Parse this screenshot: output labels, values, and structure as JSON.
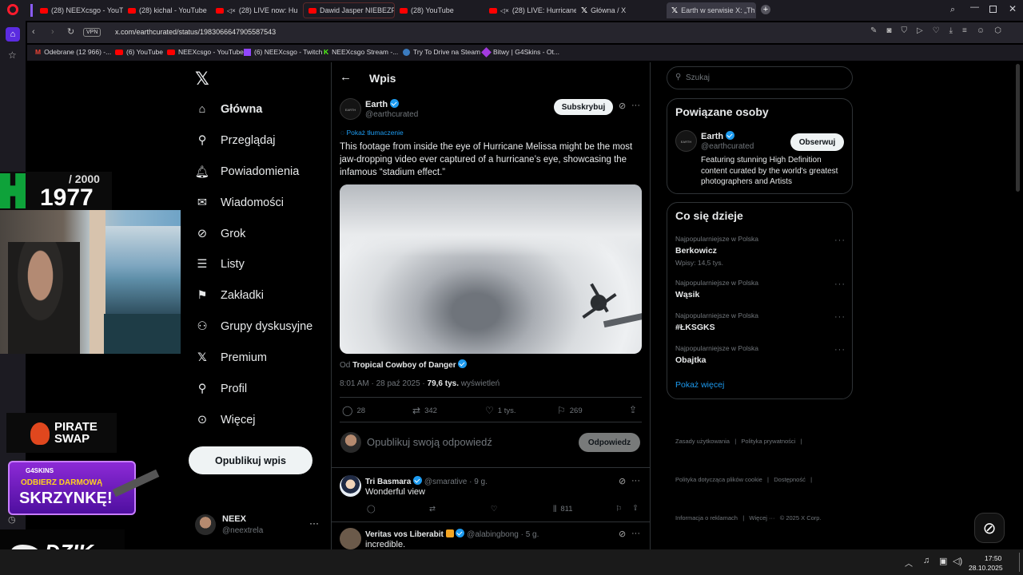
{
  "browser": {
    "tabs": [
      {
        "label": "(28) NEEXcsgo - YouTube",
        "kind": "yt"
      },
      {
        "label": "(28) kichal - YouTube",
        "kind": "yt"
      },
      {
        "label": "(28) LIVE now: Hu",
        "kind": "yt-muted"
      },
      {
        "label": "Dawid Jasper NIEBEZPIEC",
        "kind": "yt"
      },
      {
        "label": "(28) YouTube",
        "kind": "yt"
      },
      {
        "label": "(28) LIVE: Hurricane",
        "kind": "yt-muted"
      },
      {
        "label": "Główna / X",
        "kind": "x"
      },
      {
        "label": "Earth w serwisie X: „Th",
        "kind": "x"
      }
    ],
    "vpn_badge": "VPN",
    "url": "x.com/earthcurated/status/1983066647905587543",
    "bookmarks": [
      "Odebrane (12 966) -...",
      "(6) YouTube",
      "NEEXcsgo - YouTube",
      "(6) NEEXcsgo - Twitch",
      "NEEXcsgo Stream -...",
      "Try To Drive na Steam",
      "Bitwy | G4Skins - Ot..."
    ]
  },
  "overlay": {
    "counter_total": "/ 2000",
    "counter_value": "1977",
    "sponsor1": "PIRATE SWAP",
    "sponsor2_brand": "G4SKINS",
    "sponsor2_line1": "ODBIERZ DARMOWĄ",
    "sponsor2_line2": "SKRZYNKĘ!",
    "sponsor3": "DZIK."
  },
  "nav": {
    "items": [
      "Główna",
      "Przeglądaj",
      "Powiadomienia",
      "Wiadomości",
      "Grok",
      "Listy",
      "Zakładki",
      "Grupy dyskusyjne",
      "Premium",
      "Profil",
      "Więcej"
    ],
    "post_button": "Opublikuj wpis",
    "account_name": "NEEX",
    "account_handle": "@neextrela"
  },
  "post": {
    "header": "Wpis",
    "author_name": "Earth",
    "author_handle": "@earthcurated",
    "subscribe": "Subskrybuj",
    "translate": "Pokaż tłumaczenie",
    "text": "This footage from inside the eye of Hurricane Melissa might be the most jaw-dropping video ever captured of a hurricane’s eye, showcasing the infamous “stadium effect.”",
    "from_prefix": "Od",
    "from_name": "Tropical Cowboy of Danger",
    "time": "8:01 AM · 28 paź 2025 · ",
    "views": "79,6 tys.",
    "views_label": " wyświetleń",
    "replies": "28",
    "reposts": "342",
    "likes": "1 tys.",
    "bookmarks": "269",
    "reply_placeholder": "Opublikuj swoją odpowiedź",
    "reply_button": "Odpowiedz"
  },
  "replies": [
    {
      "name": "Tri Basmara",
      "handle": "@smarative · 9 g.",
      "text": "Wonderful view",
      "views": "811"
    },
    {
      "name": "Veritas vos Liberabit",
      "handle": "@alabingbong · 5 g.",
      "text": "incredible."
    }
  ],
  "sidebar": {
    "search_placeholder": "Szukaj",
    "related_title": "Powiązane osoby",
    "related_name": "Earth",
    "related_handle": "@earthcurated",
    "follow": "Obserwuj",
    "related_bio": "Featuring stunning High Definition content curated by the world's greatest photographers and Artists",
    "trends_title": "Co się dzieje",
    "trends": [
      {
        "context": "Najpopularniejsze w Polska",
        "name": "Berkowicz",
        "count": "Wpisy: 14,5 tys."
      },
      {
        "context": "Najpopularniejsze w Polska",
        "name": "Wąsik",
        "count": ""
      },
      {
        "context": "Najpopularniejsze w Polska",
        "name": "#ŁKSGKS",
        "count": ""
      },
      {
        "context": "Najpopularniejsze w Polska",
        "name": "Obajtka",
        "count": ""
      }
    ],
    "show_more": "Pokaż więcej",
    "footer1": "Zasady użytkowania   |   Polityka prywatności   |",
    "footer2": "Polityka dotycząca plików cookie   |   Dostępność   |",
    "footer3": "Informacja o reklamach   |   Więcej ···   © 2025 X Corp."
  },
  "taskbar": {
    "time": "17:50",
    "date": "28.10.2025"
  }
}
